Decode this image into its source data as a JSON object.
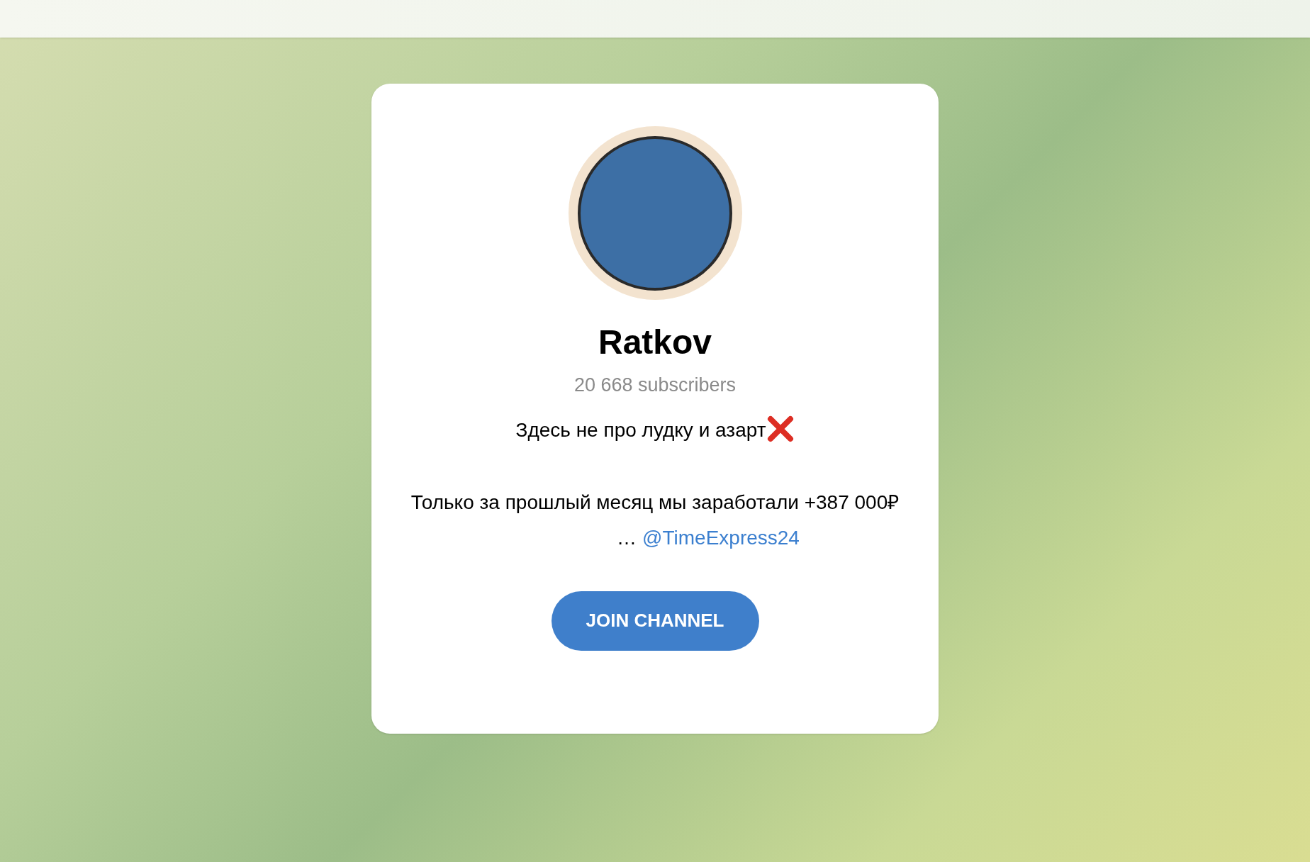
{
  "channel": {
    "title": "Ratkov",
    "subscribers": "20 668 subscribers",
    "description": [
      {
        "kind": "line_with_cross",
        "text": "Здесь не про лудку и азарт"
      },
      {
        "kind": "paragraph",
        "text": "Только за прошлый месяц мы заработали +387 000₽"
      },
      {
        "kind": "link_line",
        "text": "…",
        "link": "@TimeExpress24"
      }
    ]
  },
  "join_button": "JOIN CHANNEL"
}
